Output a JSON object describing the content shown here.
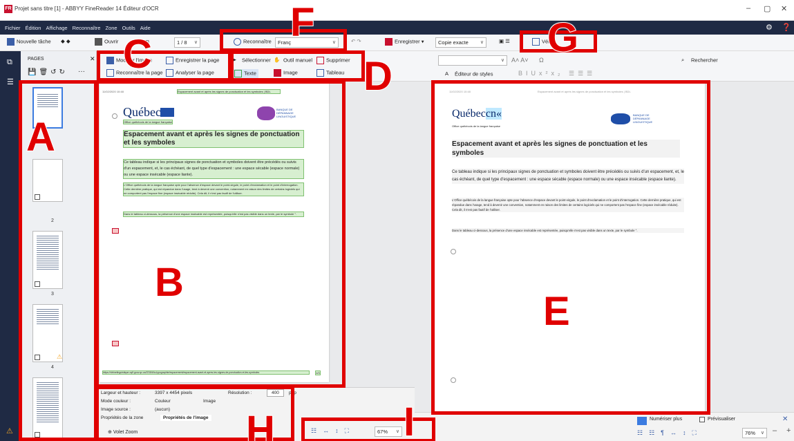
{
  "window": {
    "title": "Projet sans titre [1] - ABBYY FineReader 14 Éditeur d'OCR",
    "logo": "FR",
    "min": "–",
    "max": "▢",
    "close": "✕"
  },
  "menu": [
    "Fichier",
    "Édition",
    "Affichage",
    "Reconnaître",
    "Zone",
    "Outils",
    "Aide"
  ],
  "toolbar": {
    "new_task": "Nouvelle tâche",
    "open": "Ouvrir",
    "scan": "Num",
    "page_counter": "1 / 8",
    "recognize": "Reconnaître",
    "language": "Franç",
    "save": "Enregistrer",
    "save_mode": "Copie exacte",
    "verify": "Vér"
  },
  "pages_panel": {
    "title": "PAGES",
    "close": "✕",
    "more": "···",
    "pages": [
      "2",
      "3",
      "4"
    ]
  },
  "ribbon": {
    "modify_image": "Modifier l'image",
    "recognize_page": "Reconnaître la page",
    "save_page": "Enregistrer la page",
    "analyze_page": "Analyser la page",
    "select": "Sélectionner",
    "manual_tool": "Outil manuel",
    "delete": "Supprimer",
    "text": "Texte",
    "image": "Image",
    "table": "Tableau",
    "style_editor": "Éditeur de styles",
    "search": "Rechercher",
    "font_a_big": "A",
    "font_a_small": "A",
    "omega": "Ω"
  },
  "doc": {
    "header_date": "11/02/2020 10:48",
    "header_title": "Espacement avant et après les signes de ponctuation et les symboles | BDL",
    "brand": "Québec",
    "brand_suffix": "cn«",
    "office": "Office québécois de la langue française",
    "bank": "BANQUE DE DÉPANNAGE LINGUISTIQUE",
    "heading": "Espacement avant et après les signes de ponctuation et les symboles",
    "p1": "Ce tableau indique si les principaux signes de ponctuation et symboles doivent être précédés ou suivis d'un espacement, et, le cas échéant, de quel type d'espacement : une espace sécable (espace normale) ou une espace insécable (espace liante).",
    "p2": "L'Office québécois de la langue française opte pour l'absence d'espace devant le point-virgule, le point d'exclamation et le point d'interrogation. Cette dernière pratique, qui est répandue dans l'usage, tend à devenir une convention, notamment en raison des limites de certains logiciels qui ne comportent pas l'espace fine (espace insécable réduite). Cela dit, il n'est pas fautif de l'utiliser.",
    "p3": "Dans le tableau ci-dessous, la présence d'une espace insécable est représentée, puisqu'elle n'est pas visible dans un texte, par le symbole °.",
    "url": "https://vitrinelinguistique.oqlf.gouv.qc.ca/22184/la-typographie/espacement/espacement-avant-et-apres-les-signes-de-ponctuation-et-les-symboles",
    "url_page": "1/3"
  },
  "props": {
    "size_label": "Largeur et hauteur :",
    "size_value": "3397 x 4454 pixels",
    "res_label": "Résolution :",
    "res_value": "400",
    "res_unit": "ppp",
    "color_label": "Mode couleur :",
    "color_value": "Couleur",
    "color_type": "Image",
    "source_label": "Image source :",
    "source_value": "(aucun)",
    "tab_zone": "Propriétés de la zone",
    "tab_image": "Propriétés de l'image",
    "zoom_panel": "Volet Zoom"
  },
  "zoom": {
    "left": "67%",
    "right": "76%"
  },
  "bottom": {
    "numerize": "Numériser plus",
    "preview": "Prévisualiser"
  },
  "labels": {
    "A": "A",
    "B": "B",
    "C": "C",
    "D": "D",
    "E": "E",
    "F": "F",
    "G": "G",
    "H": "H",
    "I": "I"
  },
  "colors": {
    "annotation": "#e00000",
    "menubar": "#1f2a44",
    "green_zone": "#d7efd0"
  }
}
